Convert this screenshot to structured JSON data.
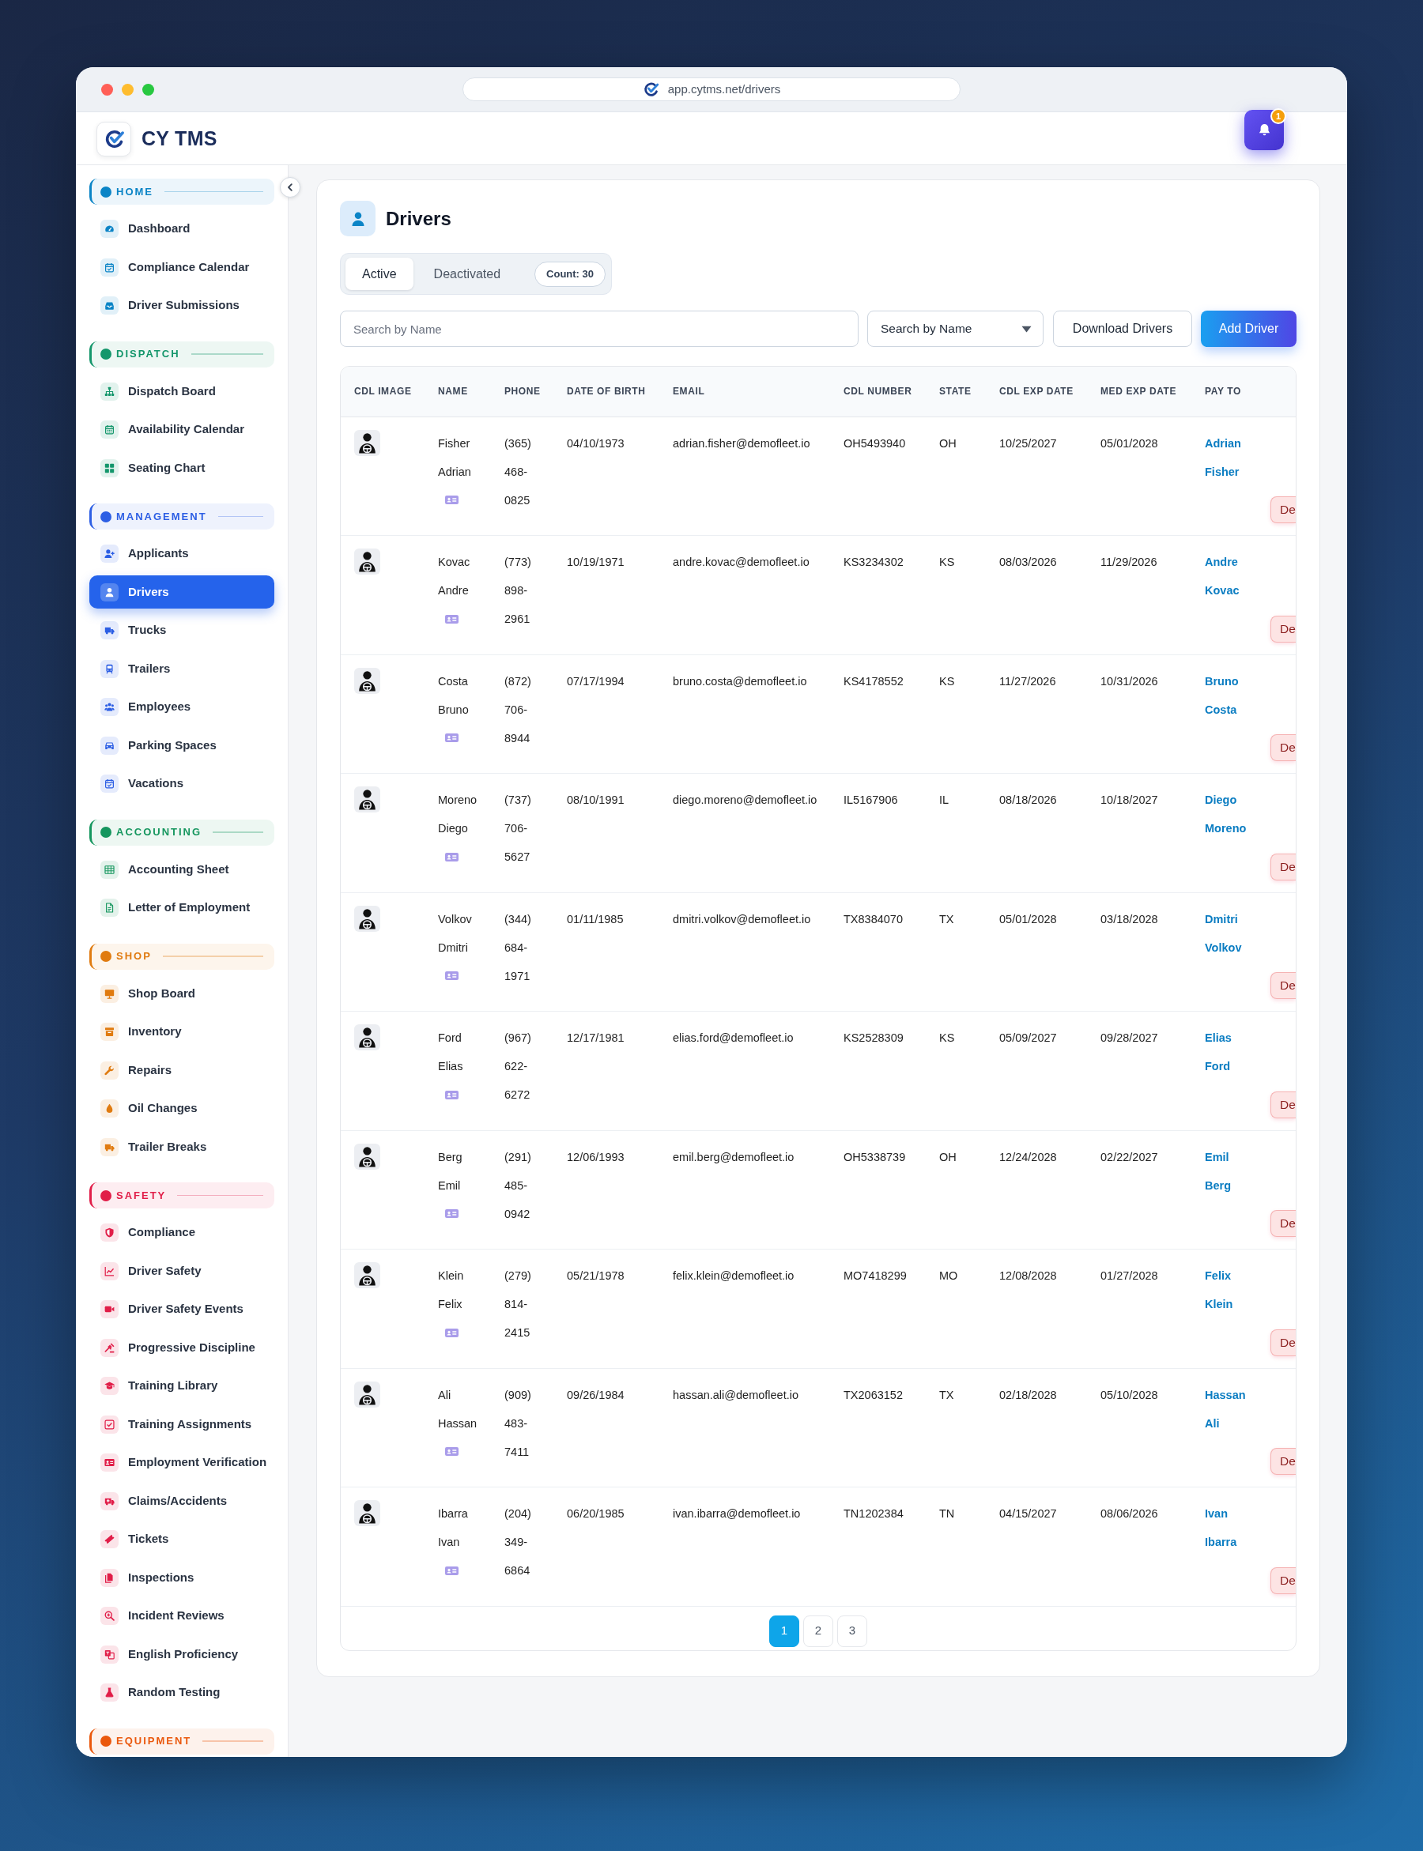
{
  "browser": {
    "address": "app.cytms.net/drivers"
  },
  "header": {
    "brand": "CY TMS",
    "notification_count": "1"
  },
  "sidebar": {
    "sections": [
      {
        "title": "HOME",
        "color": "#0b84c6",
        "items": [
          {
            "label": "Dashboard",
            "selected": false
          },
          {
            "label": "Compliance Calendar",
            "selected": false
          },
          {
            "label": "Driver Submissions",
            "selected": false
          }
        ]
      },
      {
        "title": "DISPATCH",
        "color": "#14966b",
        "items": [
          {
            "label": "Dispatch Board",
            "selected": false
          },
          {
            "label": "Availability Calendar",
            "selected": false
          },
          {
            "label": "Seating Chart",
            "selected": false
          }
        ]
      },
      {
        "title": "MANAGEMENT",
        "color": "#2c5ee4",
        "items": [
          {
            "label": "Applicants",
            "selected": false
          },
          {
            "label": "Drivers",
            "selected": true
          },
          {
            "label": "Trucks",
            "selected": false
          },
          {
            "label": "Trailers",
            "selected": false
          },
          {
            "label": "Employees",
            "selected": false
          },
          {
            "label": "Parking Spaces",
            "selected": false
          },
          {
            "label": "Vacations",
            "selected": false
          }
        ]
      },
      {
        "title": "ACCOUNTING",
        "color": "#15965e",
        "items": [
          {
            "label": "Accounting Sheet",
            "selected": false
          },
          {
            "label": "Letter of Employment",
            "selected": false
          }
        ]
      },
      {
        "title": "SHOP",
        "color": "#e07b10",
        "items": [
          {
            "label": "Shop Board",
            "selected": false
          },
          {
            "label": "Inventory",
            "selected": false
          },
          {
            "label": "Repairs",
            "selected": false
          },
          {
            "label": "Oil Changes",
            "selected": false
          },
          {
            "label": "Trailer Breaks",
            "selected": false
          }
        ]
      },
      {
        "title": "SAFETY",
        "color": "#e11d48",
        "items": [
          {
            "label": "Compliance",
            "selected": false
          },
          {
            "label": "Driver Safety",
            "selected": false
          },
          {
            "label": "Driver Safety Events",
            "selected": false
          },
          {
            "label": "Progressive Discipline",
            "selected": false
          },
          {
            "label": "Training Library",
            "selected": false
          },
          {
            "label": "Training Assignments",
            "selected": false
          },
          {
            "label": "Employment Verification",
            "selected": false
          },
          {
            "label": "Claims/Accidents",
            "selected": false
          },
          {
            "label": "Tickets",
            "selected": false
          },
          {
            "label": "Inspections",
            "selected": false
          },
          {
            "label": "Incident Reviews",
            "selected": false
          },
          {
            "label": "English Proficiency",
            "selected": false
          },
          {
            "label": "Random Testing",
            "selected": false
          }
        ]
      },
      {
        "title": "EQUIPMENT",
        "color": "#ea580c"
      }
    ]
  },
  "page": {
    "title": "Drivers",
    "tabs": [
      {
        "label": "Active",
        "selected": true
      },
      {
        "label": "Deactivated",
        "selected": false
      }
    ],
    "count": "Count: 30",
    "search": {
      "placeholder": "Search by Name"
    },
    "search_by": {
      "value": "Search by Name"
    },
    "buttons": [
      {
        "label": "Download Drivers",
        "kind": "outline"
      },
      {
        "label": "Add Driver",
        "kind": "primary"
      }
    ],
    "table": {
      "columns": [
        "CDL IMAGE",
        "NAME",
        "PHONE",
        "DATE OF BIRTH",
        "EMAIL",
        "CDL NUMBER",
        "STATE",
        "CDL EXP DATE",
        "MED EXP DATE",
        "PAY TO"
      ],
      "rows": [
        {
          "name": "Fisher Adrian",
          "phone": "(365) 468-0825",
          "date_of_birth": "04/10/1973",
          "email": "adrian.fisher@demofleet.io",
          "cdl_number": "OH5493940",
          "state": "OH",
          "cdl_exp_date": "10/25/2027",
          "med_exp_date": "05/01/2028",
          "pay_to": "Adrian Fisher",
          "action": "De"
        },
        {
          "name": "Kovac Andre",
          "phone": "(773) 898-2961",
          "date_of_birth": "10/19/1971",
          "email": "andre.kovac@demofleet.io",
          "cdl_number": "KS3234302",
          "state": "KS",
          "cdl_exp_date": "08/03/2026",
          "med_exp_date": "11/29/2026",
          "pay_to": "Andre Kovac",
          "action": "De"
        },
        {
          "name": "Costa Bruno",
          "phone": "(872) 706-8944",
          "date_of_birth": "07/17/1994",
          "email": "bruno.costa@demofleet.io",
          "cdl_number": "KS4178552",
          "state": "KS",
          "cdl_exp_date": "11/27/2026",
          "med_exp_date": "10/31/2026",
          "pay_to": "Bruno Costa",
          "action": "De"
        },
        {
          "name": "Moreno Diego",
          "phone": "(737) 706-5627",
          "date_of_birth": "08/10/1991",
          "email": "diego.moreno@demofleet.io",
          "cdl_number": "IL5167906",
          "state": "IL",
          "cdl_exp_date": "08/18/2026",
          "med_exp_date": "10/18/2027",
          "pay_to": "Diego Moreno",
          "action": "De"
        },
        {
          "name": "Volkov Dmitri",
          "phone": "(344) 684-1971",
          "date_of_birth": "01/11/1985",
          "email": "dmitri.volkov@demofleet.io",
          "cdl_number": "TX8384070",
          "state": "TX",
          "cdl_exp_date": "05/01/2028",
          "med_exp_date": "03/18/2028",
          "pay_to": "Dmitri Volkov",
          "action": "De"
        },
        {
          "name": "Ford Elias",
          "phone": "(967) 622-6272",
          "date_of_birth": "12/17/1981",
          "email": "elias.ford@demofleet.io",
          "cdl_number": "KS2528309",
          "state": "KS",
          "cdl_exp_date": "05/09/2027",
          "med_exp_date": "09/28/2027",
          "pay_to": "Elias Ford",
          "action": "De"
        },
        {
          "name": "Berg Emil",
          "phone": "(291) 485-0942",
          "date_of_birth": "12/06/1993",
          "email": "emil.berg@demofleet.io",
          "cdl_number": "OH5338739",
          "state": "OH",
          "cdl_exp_date": "12/24/2028",
          "med_exp_date": "02/22/2027",
          "pay_to": "Emil Berg",
          "action": "De"
        },
        {
          "name": "Klein Felix",
          "phone": "(279) 814-2415",
          "date_of_birth": "05/21/1978",
          "email": "felix.klein@demofleet.io",
          "cdl_number": "MO7418299",
          "state": "MO",
          "cdl_exp_date": "12/08/2028",
          "med_exp_date": "01/27/2028",
          "pay_to": "Felix Klein",
          "action": "De"
        },
        {
          "name": "Ali Hassan",
          "phone": "(909) 483-7411",
          "date_of_birth": "09/26/1984",
          "email": "hassan.ali@demofleet.io",
          "cdl_number": "TX2063152",
          "state": "TX",
          "cdl_exp_date": "02/18/2028",
          "med_exp_date": "05/10/2028",
          "pay_to": "Hassan Ali",
          "action": "De"
        },
        {
          "name": "Ibarra Ivan",
          "phone": "(204) 349-6864",
          "date_of_birth": "06/20/1985",
          "email": "ivan.ibarra@demofleet.io",
          "cdl_number": "TN1202384",
          "state": "TN",
          "cdl_exp_date": "04/15/2027",
          "med_exp_date": "08/06/2026",
          "pay_to": "Ivan Ibarra",
          "action": "De"
        }
      ]
    },
    "pagination": [
      {
        "label": "1",
        "selected": true
      },
      {
        "label": "2",
        "selected": false
      },
      {
        "label": "3",
        "selected": false
      }
    ]
  }
}
